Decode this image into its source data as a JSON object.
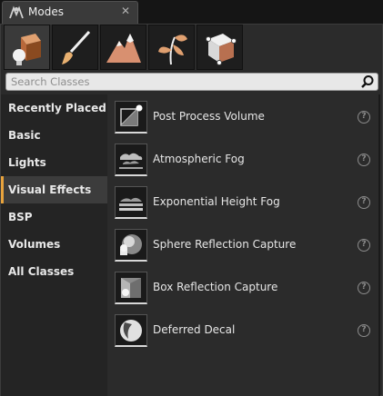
{
  "window": {
    "tab_title": "Modes",
    "close_glyph": "✕"
  },
  "modes": {
    "buttons": [
      {
        "name": "place-mode",
        "icon": "place-mode-icon",
        "active": true
      },
      {
        "name": "paint-mode",
        "icon": "paint-brush-icon",
        "active": false
      },
      {
        "name": "landscape-mode",
        "icon": "mountain-icon",
        "active": false
      },
      {
        "name": "foliage-mode",
        "icon": "leaf-icon",
        "active": false
      },
      {
        "name": "geometry-mode",
        "icon": "geometry-cube-icon",
        "active": false
      }
    ]
  },
  "search": {
    "placeholder": "Search Classes"
  },
  "categories": [
    {
      "label": "Recently Placed",
      "active": false
    },
    {
      "label": "Basic",
      "active": false
    },
    {
      "label": "Lights",
      "active": false
    },
    {
      "label": "Visual Effects",
      "active": true
    },
    {
      "label": "BSP",
      "active": false
    },
    {
      "label": "Volumes",
      "active": false
    },
    {
      "label": "All Classes",
      "active": false
    }
  ],
  "items": [
    {
      "label": "Post Process Volume",
      "icon": "post-process-volume-icon",
      "help": "?"
    },
    {
      "label": "Atmospheric Fog",
      "icon": "atmospheric-fog-icon",
      "help": "?"
    },
    {
      "label": "Exponential Height Fog",
      "icon": "exponential-height-fog-icon",
      "help": "?"
    },
    {
      "label": "Sphere Reflection Capture",
      "icon": "sphere-reflection-capture-icon",
      "help": "?"
    },
    {
      "label": "Box Reflection Capture",
      "icon": "box-reflection-capture-icon",
      "help": "?"
    },
    {
      "label": "Deferred Decal",
      "icon": "deferred-decal-icon",
      "help": "?"
    }
  ],
  "colors": {
    "accent": "#e8a33d",
    "panel": "#2b2b2b",
    "sidebar": "#242424"
  }
}
